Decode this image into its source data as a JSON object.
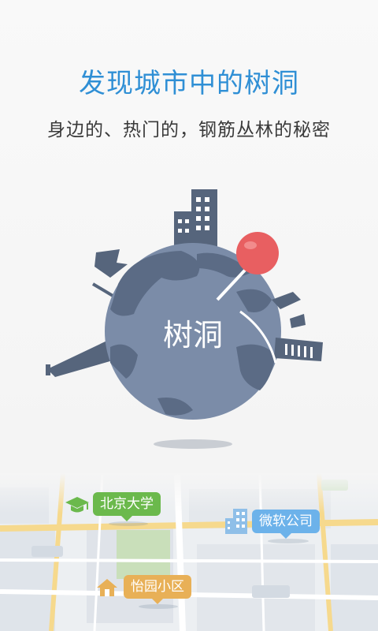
{
  "header": {
    "title": "发现城市中的树洞",
    "subtitle": "身边的、热门的，钢筋丛林的秘密"
  },
  "globe": {
    "label": "树洞"
  },
  "map": {
    "pins": [
      {
        "label": "北京大学",
        "icon": "graduation-cap-icon",
        "color": "#6bb94c"
      },
      {
        "label": "微软公司",
        "icon": "office-building-icon",
        "color": "#6cb2ea"
      },
      {
        "label": "怡园小区",
        "icon": "house-icon",
        "color": "#e8b057"
      }
    ]
  },
  "colors": {
    "accent": "#2f8fd5",
    "globe": "#7b8ca8",
    "land": "#5b6b85",
    "pin_red": "#e85f61"
  }
}
